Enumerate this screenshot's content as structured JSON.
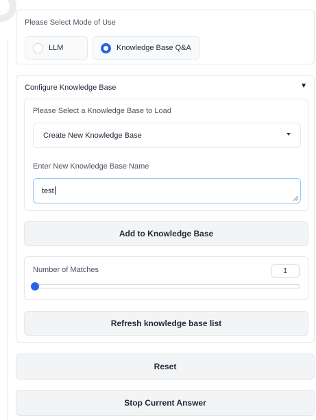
{
  "mode": {
    "label": "Please Select Mode of Use",
    "options": [
      {
        "label": "LLM",
        "checked": false
      },
      {
        "label": "Knowledge Base Q&A",
        "checked": true
      }
    ]
  },
  "config": {
    "title": "Configure Knowledge Base",
    "toggle_icon": "▼",
    "kb_select_label": "Please Select a Knowledge Base to Load",
    "kb_select_value": "Create New Knowledge Base",
    "kb_name_label": "Enter New Knowledge Base Name",
    "kb_name_value": "test",
    "add_button": "Add to Knowledge Base",
    "matches_label": "Number of Matches",
    "matches_value": "1",
    "matches_fraction": 0.0,
    "refresh_button": "Refresh knowledge base list"
  },
  "reset_button": "Reset",
  "stop_button": "Stop Current Answer",
  "colors": {
    "accent": "#2563eb",
    "focus_border": "#93c5fd",
    "button_bg": "#f3f4f6"
  }
}
